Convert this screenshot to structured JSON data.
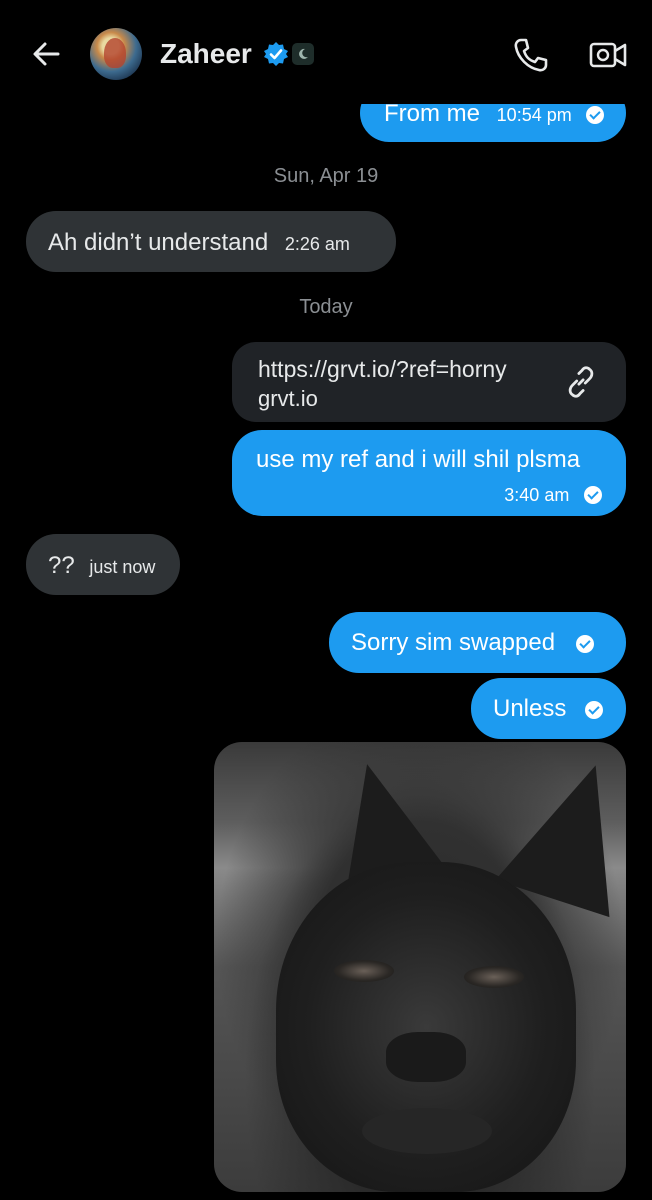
{
  "header": {
    "name": "Zaheer",
    "back_icon": "arrow-left-icon",
    "verified_icon": "verified-badge-icon",
    "call_icon": "phone-icon",
    "video_icon": "video-call-icon"
  },
  "messages": [
    {
      "direction": "out",
      "text": "From me",
      "time": "10:54 pm"
    },
    {
      "date_separator": "Sun, Apr 19"
    },
    {
      "direction": "in",
      "text": "Ah didn’t understand",
      "time": "2:26 am"
    },
    {
      "date_separator": "Today"
    },
    {
      "direction": "out",
      "link_url": "https://grvt.io/?ref=horny",
      "link_domain": "grvt.io",
      "link_icon": "link-icon"
    },
    {
      "direction": "out",
      "text": "use my ref and i will shil plsma",
      "time": "3:40 am"
    },
    {
      "direction": "in",
      "text": "??",
      "time": "just now"
    },
    {
      "direction": "out",
      "text": "Sorry sim swapped"
    },
    {
      "direction": "out",
      "text": "Unless"
    },
    {
      "direction": "out",
      "image": "cat-photo"
    }
  ],
  "colors": {
    "background": "#000000",
    "outgoing_bubble": "#1d9bf0",
    "incoming_bubble": "#2f3336",
    "muted_text": "#8b8f93"
  }
}
